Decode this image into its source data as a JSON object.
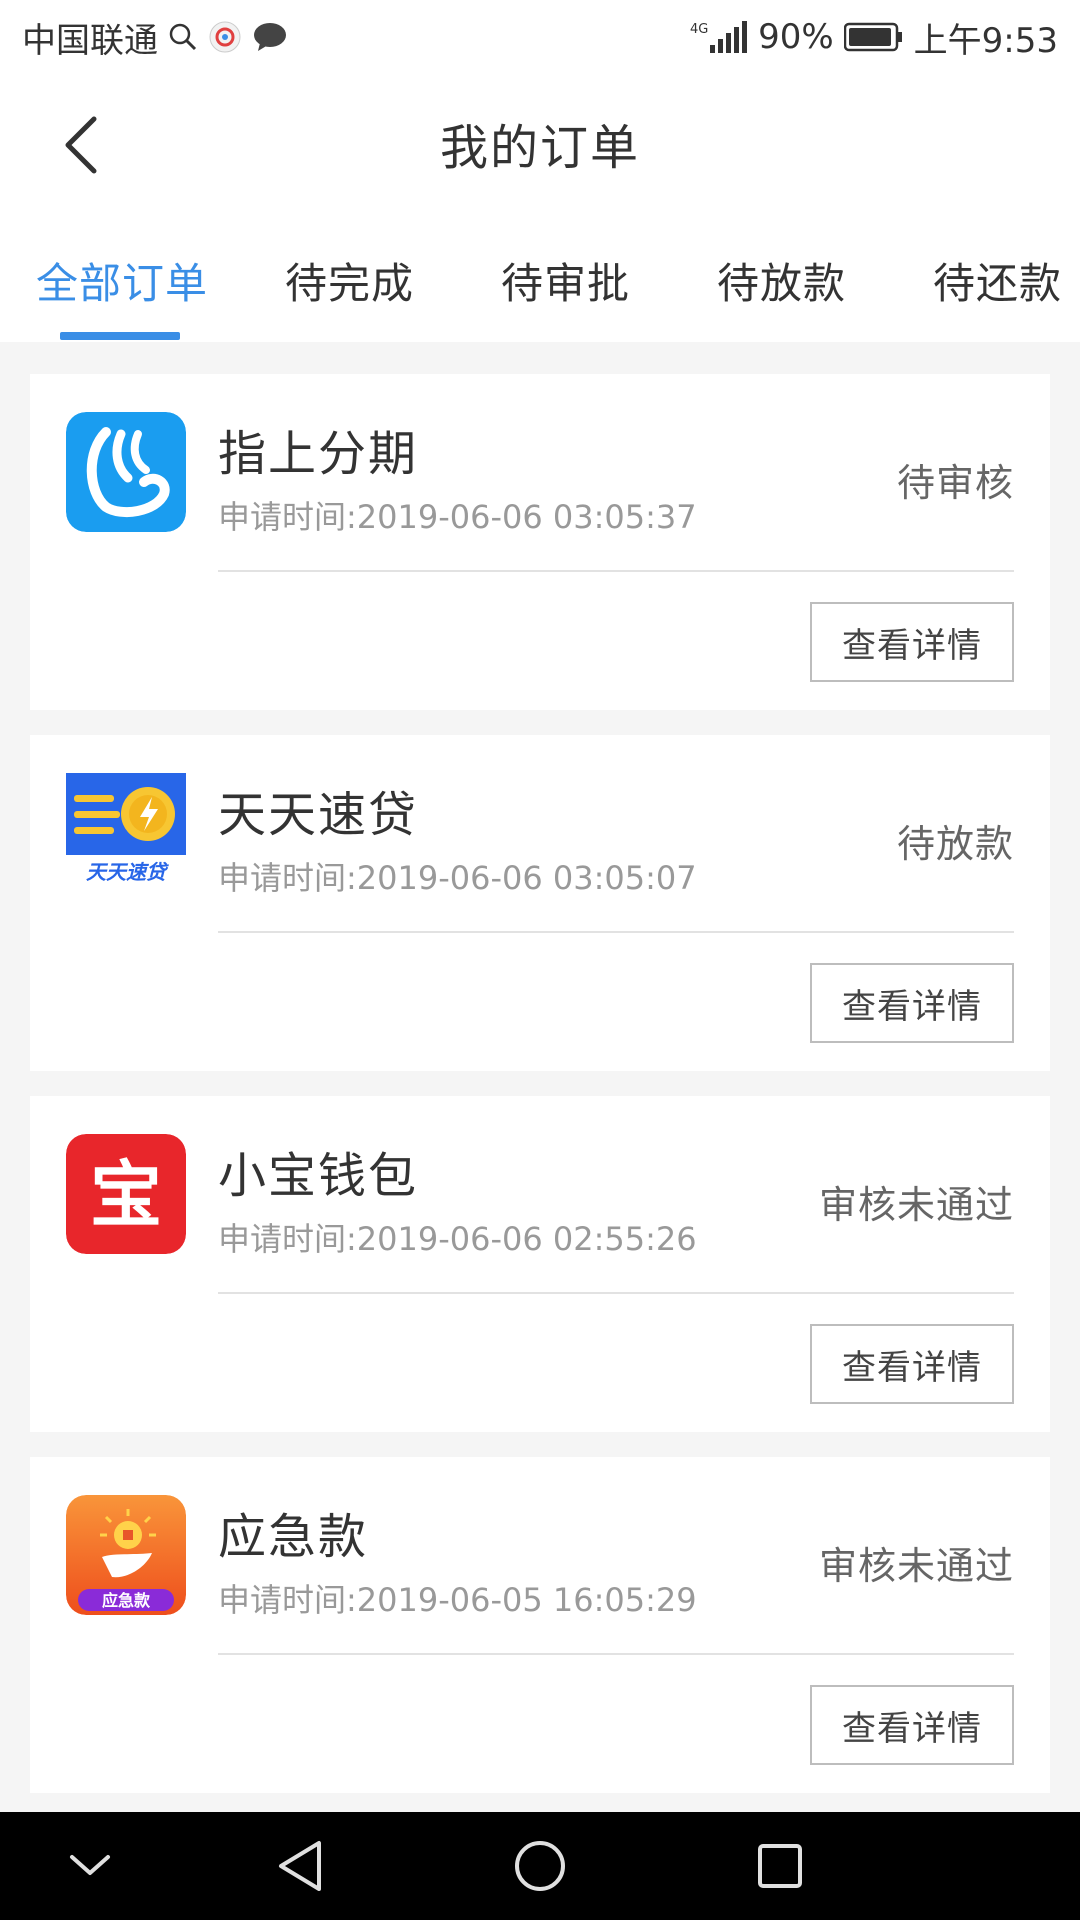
{
  "status_bar": {
    "carrier": "中国联通",
    "network": "4G",
    "battery": "90%",
    "time": "上午9:53"
  },
  "header": {
    "title": "我的订单",
    "back_icon": "chevron-left-icon"
  },
  "tabs": [
    {
      "label": "全部订单",
      "active": true
    },
    {
      "label": "待完成",
      "active": false
    },
    {
      "label": "待审批",
      "active": false
    },
    {
      "label": "待放款",
      "active": false
    },
    {
      "label": "待还款",
      "active": false
    }
  ],
  "orders": [
    {
      "name": "指上分期",
      "time": "申请时间:2019-06-06 03:05:37",
      "status": "待审核",
      "button": "查看详情",
      "logo_color": "#1a9df0"
    },
    {
      "name": "天天速贷",
      "time": "申请时间:2019-06-06 03:05:07",
      "status": "待放款",
      "button": "查看详情",
      "logo_color": "#2866e8",
      "logo_text": "天天速贷"
    },
    {
      "name": "小宝钱包",
      "time": "申请时间:2019-06-06 02:55:26",
      "status": "审核未通过",
      "button": "查看详情",
      "logo_color": "#e8262b",
      "logo_text": "宝"
    },
    {
      "name": "应急款",
      "time": "申请时间:2019-06-05 16:05:29",
      "status": "审核未通过",
      "button": "查看详情",
      "logo_color": "#f37423",
      "logo_text": "应急款"
    }
  ],
  "nav_bar": {
    "icons": [
      "collapse-icon",
      "back-triangle-icon",
      "home-circle-icon",
      "recents-square-icon"
    ]
  },
  "colors": {
    "accent": "#3a8ee6",
    "muted_text": "#999999",
    "status_text": "#666666"
  }
}
